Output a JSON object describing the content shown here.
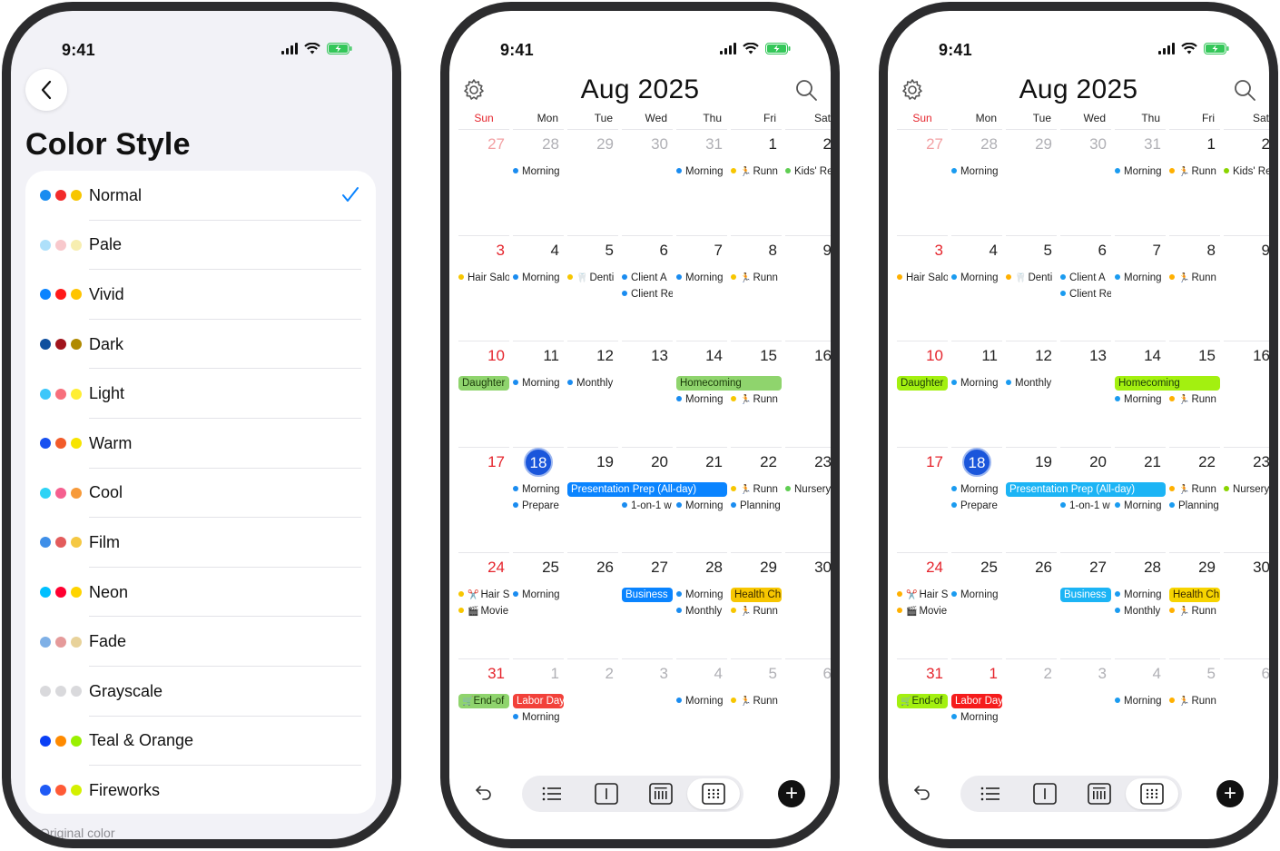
{
  "status": {
    "time": "9:41"
  },
  "color_style": {
    "title": "Color Style",
    "footer": "Original color",
    "items": [
      {
        "label": "Normal",
        "dots": [
          "#1a8cf0",
          "#f22b2b",
          "#f7c600"
        ],
        "selected": true
      },
      {
        "label": "Pale",
        "dots": [
          "#aee0fa",
          "#f8c8cc",
          "#f7eeb0"
        ],
        "selected": false
      },
      {
        "label": "Vivid",
        "dots": [
          "#0a84ff",
          "#ff1a1a",
          "#ffc400"
        ],
        "selected": false
      },
      {
        "label": "Dark",
        "dots": [
          "#0f4f9e",
          "#a1141d",
          "#b08a00"
        ],
        "selected": false
      },
      {
        "label": "Light",
        "dots": [
          "#3cc7fa",
          "#f76f7c",
          "#ffee33"
        ],
        "selected": false
      },
      {
        "label": "Warm",
        "dots": [
          "#1850f0",
          "#f25b2a",
          "#f7e400"
        ],
        "selected": false
      },
      {
        "label": "Cool",
        "dots": [
          "#2ed3f5",
          "#f55f8f",
          "#f79a3a"
        ],
        "selected": false
      },
      {
        "label": "Film",
        "dots": [
          "#3f8fe8",
          "#e35c5c",
          "#f5c843"
        ],
        "selected": false
      },
      {
        "label": "Neon",
        "dots": [
          "#00c0ff",
          "#ff0030",
          "#ffd400"
        ],
        "selected": false
      },
      {
        "label": "Fade",
        "dots": [
          "#7fb0e6",
          "#e59a9a",
          "#e8d29a"
        ],
        "selected": false
      },
      {
        "label": "Grayscale",
        "dots": [
          "#d9d9dc",
          "#d9d9dc",
          "#d9d9dc"
        ],
        "selected": false
      },
      {
        "label": "Teal & Orange",
        "dots": [
          "#0a3ff5",
          "#ff8a00",
          "#9af000"
        ],
        "selected": false
      },
      {
        "label": "Fireworks",
        "dots": [
          "#1f5af5",
          "#ff5a36",
          "#d4f000"
        ],
        "selected": false
      }
    ]
  },
  "calendar": {
    "title": "Aug 2025",
    "weekdays": [
      "Sun",
      "Mon",
      "Tue",
      "Wed",
      "Thu",
      "Fri",
      "Sat"
    ],
    "weeks": [
      [
        "27",
        "28",
        "29",
        "30",
        "31",
        "1",
        "2"
      ],
      [
        "3",
        "4",
        "5",
        "6",
        "7",
        "8",
        "9"
      ],
      [
        "10",
        "11",
        "12",
        "13",
        "14",
        "15",
        "16"
      ],
      [
        "17",
        "18",
        "19",
        "20",
        "21",
        "22",
        "23"
      ],
      [
        "24",
        "25",
        "26",
        "27",
        "28",
        "29",
        "30"
      ],
      [
        "31",
        "1",
        "2",
        "3",
        "4",
        "5",
        "6"
      ]
    ],
    "today": "18",
    "events": {
      "morning": "Morning",
      "runn": "Runn",
      "kids": "Kids' Re",
      "hair_salon": "Hair Salo",
      "dentist": "Denti",
      "client_a": "Client A",
      "client_r": "Client Re",
      "daughter": "Daughter",
      "monthly": "Monthly",
      "homecoming": "Homecoming",
      "prepare": "Prepare",
      "presentation": "Presentation Prep (All-day)",
      "one_on_one": "1-on-1 w",
      "planning": "Planning",
      "nursery": "Nursery",
      "hair_short": "Hair S",
      "movie": "Movie",
      "business": "Business",
      "health": "Health Ch",
      "end_of": "End-of",
      "labor_day": "Labor Day"
    },
    "screens": [
      {
        "id": "normal",
        "colors": {
          "blue": "#1a8cf0",
          "yellow": "#f7c600",
          "green": "#5fce52",
          "bar_blue": "#0a84ff",
          "bar_green": "#8fd46d",
          "bar_yellow": "#f7c600",
          "bar_red": "#f2413a"
        }
      },
      {
        "id": "teal_orange",
        "colors": {
          "blue": "#1a9bf0",
          "yellow": "#ffb000",
          "green": "#8ad400",
          "bar_blue": "#1cb4f5",
          "bar_green": "#a3f010",
          "bar_yellow": "#f7d400",
          "bar_red": "#f51c1c"
        }
      }
    ]
  }
}
